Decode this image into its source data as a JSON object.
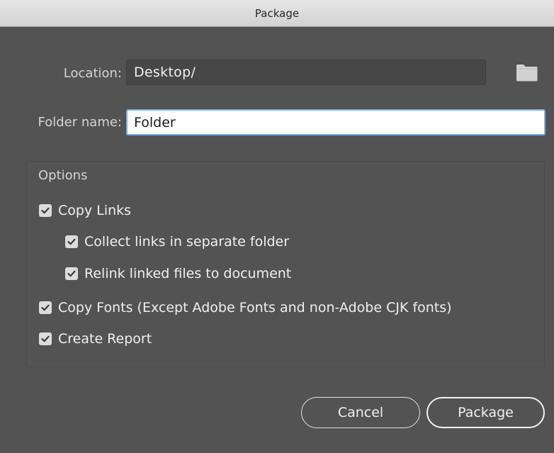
{
  "window": {
    "title": "Package"
  },
  "location": {
    "label": "Location:",
    "value": "Desktop/",
    "browse_icon": "folder-icon"
  },
  "folder_name": {
    "label": "Folder name:",
    "value": "Folder"
  },
  "options": {
    "title": "Options",
    "items": [
      {
        "label": "Copy Links",
        "checked": true
      },
      {
        "label": "Collect links in separate folder",
        "checked": true
      },
      {
        "label": "Relink linked files to document",
        "checked": true
      },
      {
        "label": "Copy Fonts (Except Adobe Fonts and non-Adobe CJK fonts)",
        "checked": true
      },
      {
        "label": "Create Report",
        "checked": true
      }
    ]
  },
  "buttons": {
    "cancel": "Cancel",
    "package": "Package"
  },
  "colors": {
    "dialog_bg": "#535353",
    "focus_border": "#7ab0e6",
    "checkbox_fill": "#dcdcdc"
  }
}
